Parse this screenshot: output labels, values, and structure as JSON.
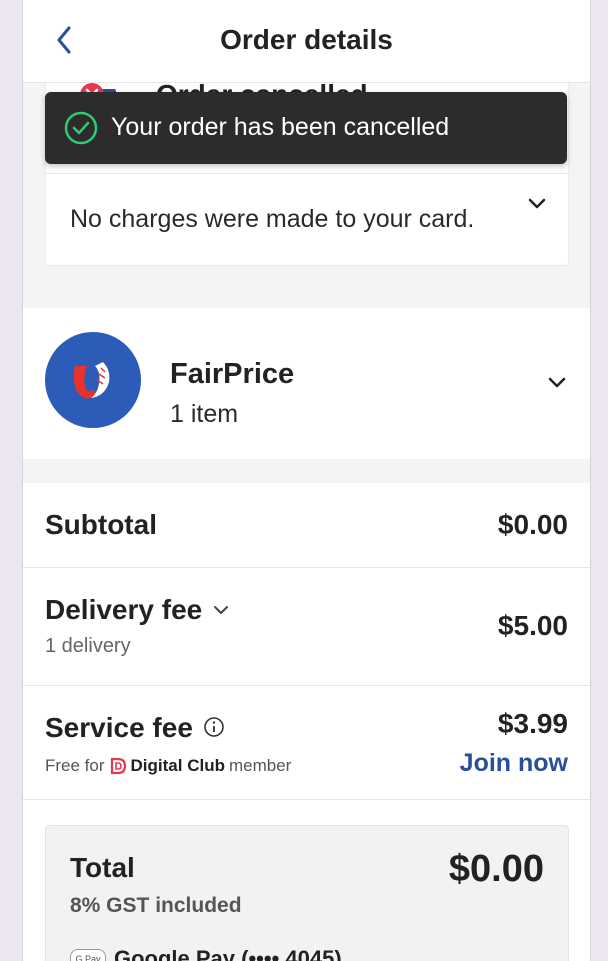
{
  "header": {
    "title": "Order details"
  },
  "status": {
    "heading": "Order cancelled",
    "message": "No charges were made to your card."
  },
  "toast": {
    "text": "Your order has been cancelled"
  },
  "store": {
    "name": "FairPrice",
    "items": "1 item"
  },
  "fees": {
    "subtotal_label": "Subtotal",
    "subtotal_value": "$0.00",
    "delivery_label": "Delivery fee",
    "delivery_sub": "1 delivery",
    "delivery_value": "$5.00",
    "service_label": "Service fee",
    "service_value": "$3.99",
    "free_for": "Free for",
    "club_name": "Digital Club",
    "member": "member",
    "join_label": "Join now"
  },
  "total": {
    "label": "Total",
    "value": "$0.00",
    "gst": "8% GST included",
    "payment_badge": "G Pay",
    "payment_method": "Google Pay (•••• 4045)"
  },
  "colors": {
    "brand_blue": "#2a4f9a",
    "toast_bg": "#2c2c2c",
    "success_green": "#2ecc71",
    "cancel_red": "#e53950"
  }
}
